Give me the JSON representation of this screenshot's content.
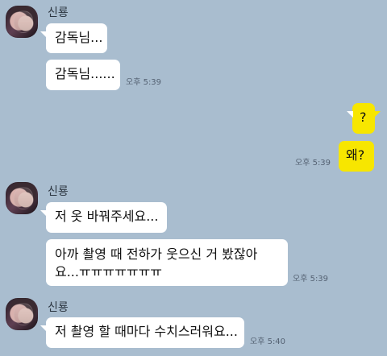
{
  "chat": {
    "senders": [
      {
        "name": "신룡"
      },
      {
        "name": "신룡"
      },
      {
        "name": "신룡"
      }
    ],
    "messages": [
      {
        "text": "감독님..."
      },
      {
        "text": "감독님......"
      },
      {
        "text": "?"
      },
      {
        "text": "왜?"
      },
      {
        "text": "저 옷 바꿔주세요..."
      },
      {
        "line1": "아까 촬영 때 전하가 웃으신 거 봤잖아",
        "line2": "요...ㅠㅠㅠㅠㅠㅠㅠ"
      },
      {
        "text": "저 촬영 할 때마다 수치스러워요..."
      }
    ],
    "timestamps": [
      {
        "text": "오후 5:39"
      },
      {
        "text": "오후 5:39"
      },
      {
        "text": "오후 5:39"
      },
      {
        "text": "오후 5:40"
      }
    ]
  }
}
